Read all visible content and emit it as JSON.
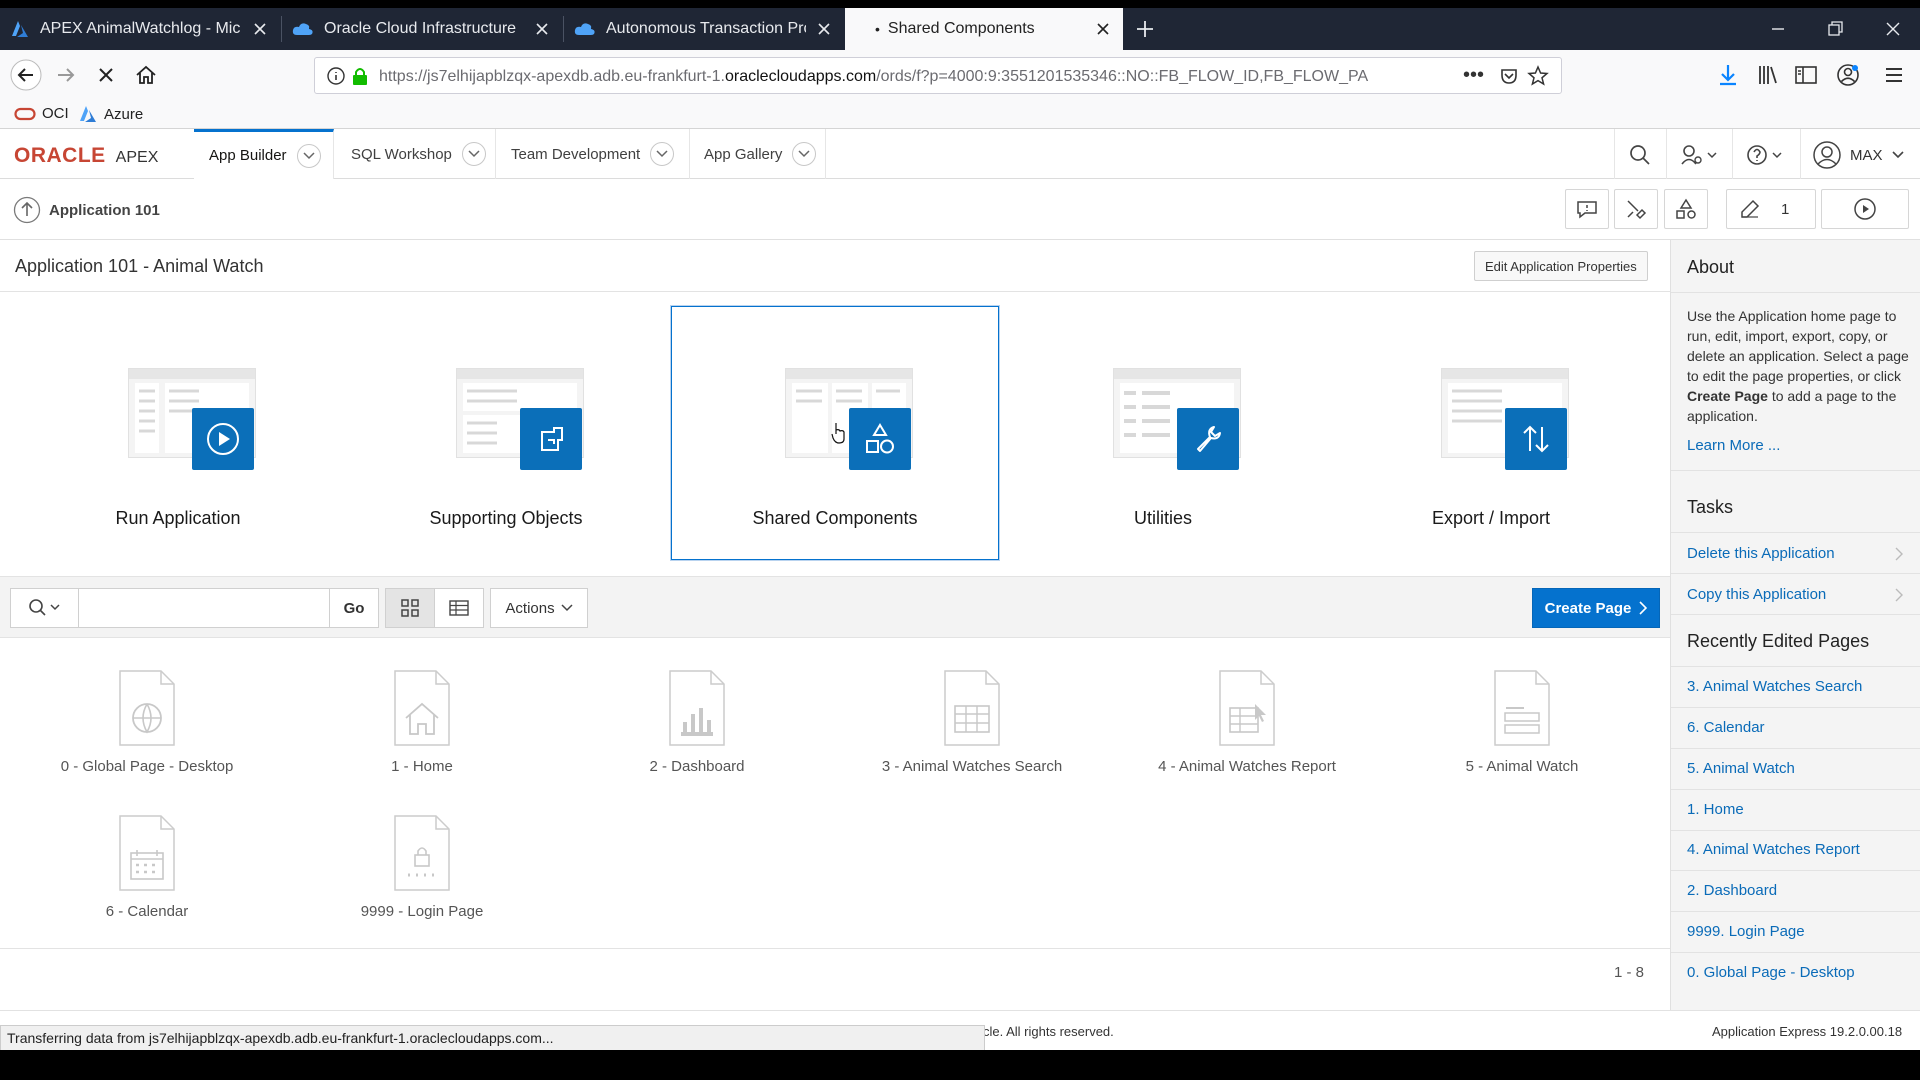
{
  "browser": {
    "tabs": [
      {
        "title": "APEX AnimalWatchlog - Micro"
      },
      {
        "title": "Oracle Cloud Infrastructure"
      },
      {
        "title": "Autonomous Transaction Proce"
      },
      {
        "title": "Shared Components"
      }
    ],
    "url_prefix": "https://js7elhijapblzqx-apexdb.adb.eu-frankfurt-1.",
    "url_domain": "oraclecloudapps.com",
    "url_suffix": "/ords/f?p=4000:9:3551201535346::NO::FB_FLOW_ID,FB_FLOW_PA",
    "bookmarks": [
      "OCI",
      "Azure"
    ]
  },
  "apex": {
    "logo_oracle": "ORACLE",
    "logo_apex": "APEX",
    "nav": [
      "App Builder",
      "SQL Workshop",
      "Team Development",
      "App Gallery"
    ],
    "user": "MAX",
    "breadcrumb": "Application 101",
    "edit_count": "1"
  },
  "main": {
    "title": "Application 101 - Animal Watch",
    "edit_props_label": "Edit Application Properties",
    "cards": [
      "Run Application",
      "Supporting Objects",
      "Shared Components",
      "Utilities",
      "Export / Import"
    ],
    "go_label": "Go",
    "actions_label": "Actions",
    "create_page_label": "Create Page",
    "pages": [
      {
        "label": "0 - Global Page - Desktop",
        "icon": "globe-page-icon"
      },
      {
        "label": "1 - Home",
        "icon": "home-page-icon"
      },
      {
        "label": "2 - Dashboard",
        "icon": "chart-page-icon"
      },
      {
        "label": "3 - Animal Watches Search",
        "icon": "grid-page-icon"
      },
      {
        "label": "4 - Animal Watches Report",
        "icon": "report-page-icon"
      },
      {
        "label": "5 - Animal Watch",
        "icon": "form-page-icon"
      },
      {
        "label": "6 - Calendar",
        "icon": "calendar-page-icon"
      },
      {
        "label": "9999 - Login Page",
        "icon": "lock-page-icon"
      }
    ],
    "pagination": "1 - 8"
  },
  "sidebar": {
    "about_title": "About",
    "about_text_1": "Use the Application home page to run, edit, import, export, copy, or delete an application. Select a page to edit the page properties, or click ",
    "about_bold": "Create Page",
    "about_text_2": " to add a page to the application.",
    "learn_more": "Learn More ...",
    "tasks_title": "Tasks",
    "tasks": [
      "Delete this Application",
      "Copy this Application"
    ],
    "recent_title": "Recently Edited Pages",
    "recent": [
      "3. Animal Watches Search",
      "6. Calendar",
      "5. Animal Watch",
      "1. Home",
      "4. Animal Watches Report",
      "2. Dashboard",
      "9999. Login Page",
      "0. Global Page - Desktop"
    ]
  },
  "footer": {
    "copyright": "cle. All rights reserved.",
    "version": "Application Express 19.2.0.00.18"
  },
  "status": "Transferring data from js7elhijapblzqx-apexdb.adb.eu-frankfurt-1.oraclecloudapps.com..."
}
